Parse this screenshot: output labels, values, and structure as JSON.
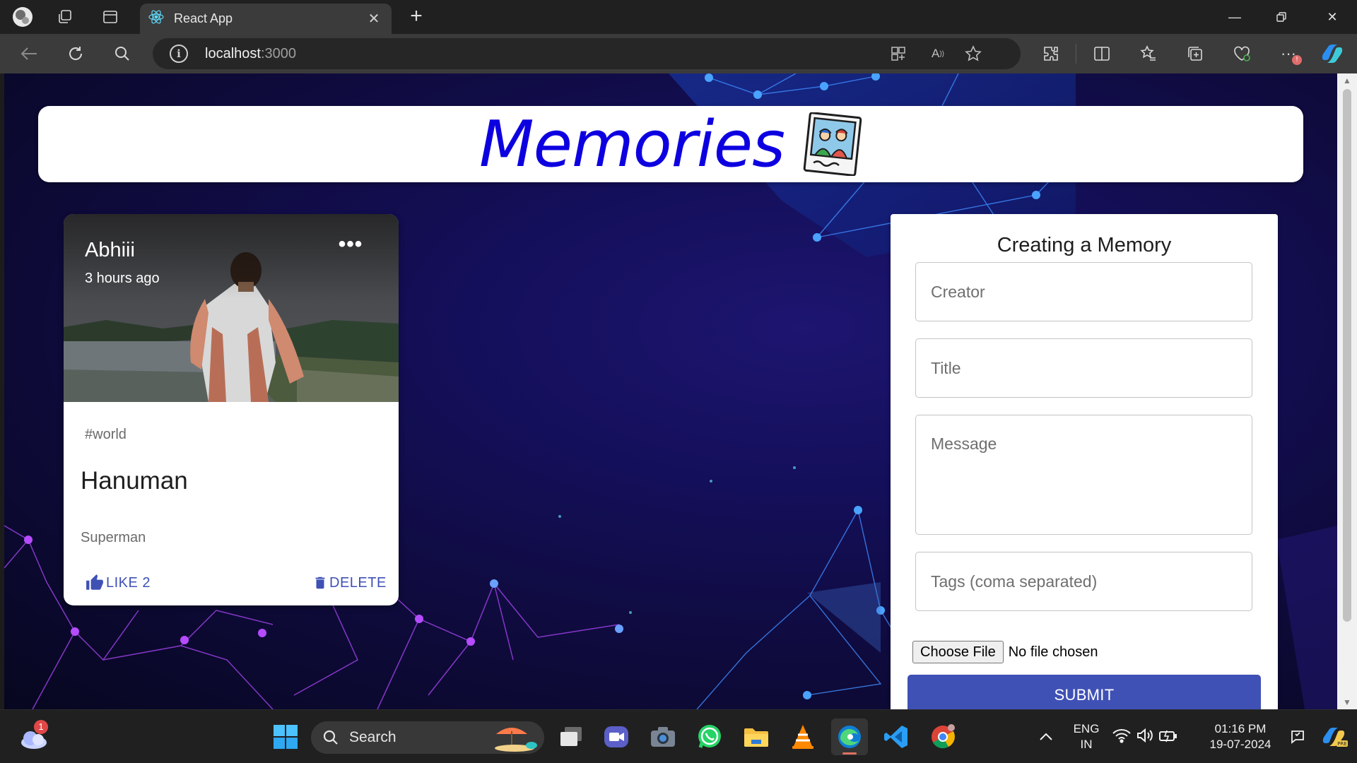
{
  "browser": {
    "tab_title": "React App",
    "url_host": "localhost",
    "url_port": ":3000"
  },
  "app": {
    "title": "Memories"
  },
  "post": {
    "creator": "Abhiii",
    "time": "3 hours ago",
    "more_label": "•••",
    "tags": "#world",
    "title": "Hanuman",
    "message": "Superman",
    "like_label": "LIKE 2",
    "like_count": 2,
    "delete_label": "DELETE"
  },
  "form": {
    "heading": "Creating a Memory",
    "creator_placeholder": "Creator",
    "title_placeholder": "Title",
    "message_placeholder": "Message",
    "tags_placeholder": "Tags (coma separated)",
    "file_button": "Choose File",
    "file_status": "No file chosen",
    "submit_label": "SUBMIT"
  },
  "taskbar": {
    "search_label": "Search",
    "weather_badge": "1",
    "language_line1": "ENG",
    "language_line2": "IN",
    "time": "01:16 PM",
    "date": "19-07-2024"
  },
  "colors": {
    "accent": "#3f51b5",
    "title_blue": "#0d00e0",
    "page_bg": "#140f5a"
  }
}
